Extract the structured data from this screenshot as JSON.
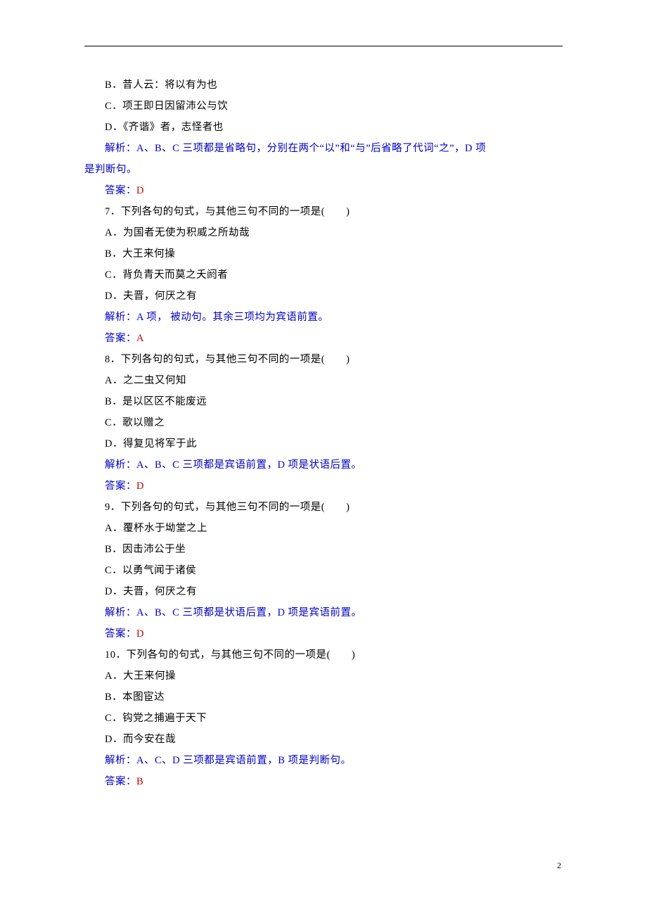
{
  "lines": [
    {
      "cls": "line indent",
      "color": "",
      "key": "l0",
      "text": "B．昔人云：将以有为也"
    },
    {
      "cls": "line indent",
      "color": "",
      "key": "l1",
      "text": "C．项王即日因留沛公与饮"
    },
    {
      "cls": "line indent",
      "color": "",
      "key": "l2",
      "text": "D．《齐谐》者，志怪者也"
    },
    {
      "cls": "line indent",
      "color": "blue",
      "key": "l3a",
      "prefix": "解析：",
      "text": "A、B、C 三项都是省略句，分别在两个“以”和“与”后省略了代词“之”，D 项"
    },
    {
      "cls": "line",
      "color": "blue",
      "key": "l3b",
      "text": "是判断句。"
    },
    {
      "cls": "line indent",
      "color": "mixed",
      "key": "l4",
      "prefix": "答案：",
      "answer": "D"
    },
    {
      "cls": "line indent",
      "color": "",
      "key": "l5",
      "text": "7．下列各句的句式，与其他三句不同的一项是(　　)"
    },
    {
      "cls": "line indent",
      "color": "",
      "key": "l6",
      "text": "A．为国者无使为积威之所劫哉"
    },
    {
      "cls": "line indent",
      "color": "",
      "key": "l7",
      "text": "B．大王来何操"
    },
    {
      "cls": "line indent",
      "color": "",
      "key": "l8",
      "text": "C．背负青天而莫之夭阏者"
    },
    {
      "cls": "line indent",
      "color": "",
      "key": "l9",
      "text": "D．夫晋，何厌之有"
    },
    {
      "cls": "line indent",
      "color": "blue",
      "key": "l10",
      "prefix": "解析：",
      "text": "A 项，  被动句。其余三项均为宾语前置。"
    },
    {
      "cls": "line indent",
      "color": "mixed",
      "key": "l11",
      "prefix": "答案：",
      "answer": "A"
    },
    {
      "cls": "line indent",
      "color": "",
      "key": "l12",
      "text": "8．下列各句的句式，与其他三句不同的一项是(　　)"
    },
    {
      "cls": "line indent",
      "color": "",
      "key": "l13",
      "text": "A．之二虫又何知"
    },
    {
      "cls": "line indent",
      "color": "",
      "key": "l14",
      "text": "B．是以区区不能废远"
    },
    {
      "cls": "line indent",
      "color": "",
      "key": "l15",
      "text": "C．歌以赠之"
    },
    {
      "cls": "line indent",
      "color": "",
      "key": "l16",
      "text": "D．得复见将军于此"
    },
    {
      "cls": "line indent",
      "color": "blue",
      "key": "l17",
      "prefix": "解析：",
      "text": "A、B、C 三项都是宾语前置，D 项是状语后置。"
    },
    {
      "cls": "line indent",
      "color": "mixed",
      "key": "l18",
      "prefix": "答案：",
      "answer": "D"
    },
    {
      "cls": "line indent",
      "color": "",
      "key": "l19",
      "text": "9．下列各句的句式，与其他三句不同的一项是(　　)"
    },
    {
      "cls": "line indent",
      "color": "",
      "key": "l20",
      "text": "A．覆杯水于坳堂之上"
    },
    {
      "cls": "line indent",
      "color": "",
      "key": "l21",
      "text": "B．因击沛公于坐"
    },
    {
      "cls": "line indent",
      "color": "",
      "key": "l22",
      "text": "C．以勇气闻于诸侯"
    },
    {
      "cls": "line indent",
      "color": "",
      "key": "l23",
      "text": "D．夫晋，何厌之有"
    },
    {
      "cls": "line indent",
      "color": "blue",
      "key": "l24",
      "prefix": "解析：",
      "text": "A、B、C 三项都是状语后置，D 项是宾语前置。"
    },
    {
      "cls": "line indent",
      "color": "mixed",
      "key": "l25",
      "prefix": "答案：",
      "answer": "D"
    },
    {
      "cls": "line indent",
      "color": "",
      "key": "l26",
      "text": "10．下列各句的句式，与其他三句不同的一项是(　　)"
    },
    {
      "cls": "line indent",
      "color": "",
      "key": "l27",
      "text": "A．大王来何操"
    },
    {
      "cls": "line indent",
      "color": "",
      "key": "l28",
      "text": "B．本图宦达"
    },
    {
      "cls": "line indent",
      "color": "",
      "key": "l29",
      "text": "C．钩党之捕遍于天下"
    },
    {
      "cls": "line indent",
      "color": "",
      "key": "l30",
      "text": "D．而今安在哉"
    },
    {
      "cls": "line indent",
      "color": "blue",
      "key": "l31",
      "prefix": "解析：",
      "text": "A、C、D 三项都是宾语前置，B 项是判断句。"
    },
    {
      "cls": "line indent",
      "color": "mixed",
      "key": "l32",
      "prefix": "答案：",
      "answer": "B"
    }
  ],
  "pageNumber": "2"
}
